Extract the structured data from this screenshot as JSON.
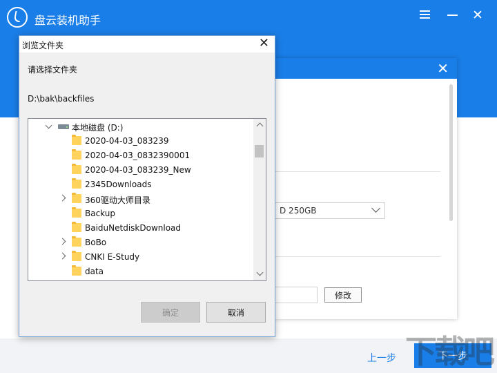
{
  "app": {
    "title": "盘云装机助手",
    "prev_label": "上一步",
    "next_label": "下一步",
    "watermark": "下载吧",
    "accent_color": "#1a7ee8"
  },
  "inner_dialog": {
    "disk_value": "D 250GB",
    "modify_label": "修改"
  },
  "browse_dialog": {
    "title": "浏览文件夹",
    "prompt": "请选择文件夹",
    "path": "D:\\bak\\backfiles",
    "tree": [
      {
        "label": "本地磁盘 (D:)",
        "icon": "drive-icon",
        "expander": "open",
        "level": 0
      },
      {
        "label": "2020-04-03_083239",
        "icon": "folder-icon",
        "expander": "none",
        "level": 1
      },
      {
        "label": "2020-04-03_0832390001",
        "icon": "folder-icon",
        "expander": "none",
        "level": 1
      },
      {
        "label": "2020-04-03_083239_New",
        "icon": "folder-icon",
        "expander": "none",
        "level": 1
      },
      {
        "label": "2345Downloads",
        "icon": "folder-icon",
        "expander": "none",
        "level": 1
      },
      {
        "label": "360驱动大师目录",
        "icon": "folder-icon",
        "expander": "closed",
        "level": 1
      },
      {
        "label": "Backup",
        "icon": "folder-icon",
        "expander": "none",
        "level": 1
      },
      {
        "label": "BaiduNetdiskDownload",
        "icon": "folder-icon",
        "expander": "none",
        "level": 1
      },
      {
        "label": "BoBo",
        "icon": "folder-icon",
        "expander": "closed",
        "level": 1
      },
      {
        "label": "CNKI E-Study",
        "icon": "folder-icon",
        "expander": "closed",
        "level": 1
      },
      {
        "label": "data",
        "icon": "folder-icon",
        "expander": "none",
        "level": 1
      }
    ],
    "ok_label": "确定",
    "cancel_label": "取消"
  }
}
